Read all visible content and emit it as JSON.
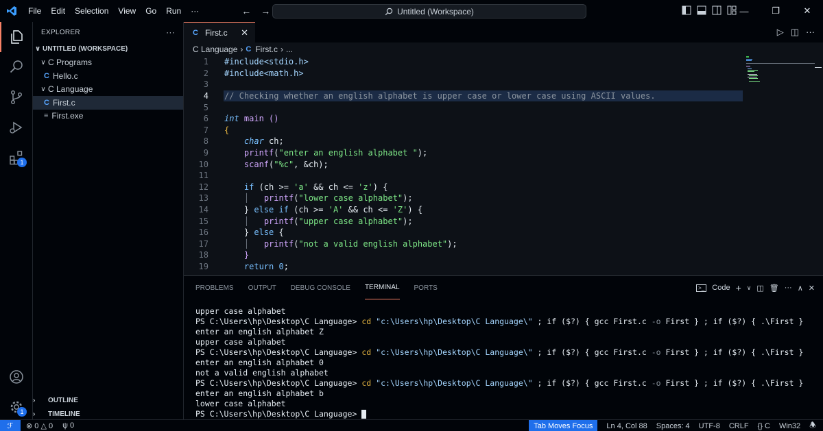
{
  "titlebar": {
    "menu": [
      "File",
      "Edit",
      "Selection",
      "View",
      "Go",
      "Run",
      "···"
    ],
    "command_center": "Untitled (Workspace)"
  },
  "activitybar": {
    "extensions_badge": "1",
    "settings_badge": "1"
  },
  "sidebar": {
    "title": "EXPLORER",
    "more": "···",
    "workspace": "UNTITLED (WORKSPACE)",
    "items": [
      {
        "label": "C Programs",
        "type": "folder"
      },
      {
        "label": "Hello.c",
        "type": "c"
      },
      {
        "label": "C Language",
        "type": "folder"
      },
      {
        "label": "First.c",
        "type": "c"
      },
      {
        "label": "First.exe",
        "type": "exe"
      }
    ],
    "outline": "OUTLINE",
    "timeline": "TIMELINE"
  },
  "editor": {
    "tab_label": "First.c",
    "breadcrumb": [
      "C Language",
      "First.c",
      "..."
    ],
    "lines": [
      "1",
      "2",
      "3",
      "4",
      "5",
      "6",
      "7",
      "8",
      "9",
      "10",
      "11",
      "12",
      "13",
      "14",
      "15",
      "16",
      "17",
      "18",
      "19"
    ],
    "code": {
      "l1": "#include<stdio.h>",
      "l2": "#include<math.h>",
      "l4": "// Checking whether an english alphabet is upper case or lower case using ASCII values.",
      "l6_type": "int",
      "l6_rest": " main ()",
      "l7": "{",
      "l8_type": "char",
      "l8_rest": " ch;",
      "l9_fn": "printf",
      "l9_str": "\"enter an english alphabet \"",
      "l10_fn": "scanf",
      "l10_str": "\"%c\"",
      "l10_rest": ", &ch);",
      "l12_if": "if",
      "l12_a": " (ch >= ",
      "l12_s1": "'a'",
      "l12_b": " && ch <= ",
      "l12_s2": "'z'",
      "l12_c": ") {",
      "l13_fn": "printf",
      "l13_str": "\"lower case alphabet\"",
      "l14_a": "} ",
      "l14_else": "else if",
      "l14_b": " (ch >= ",
      "l14_s1": "'A'",
      "l14_c": " && ch <= ",
      "l14_s2": "'Z'",
      "l14_d": ") {",
      "l15_fn": "printf",
      "l15_str": "\"upper case alphabet\"",
      "l16_a": "} ",
      "l16_else": "else",
      "l16_b": " {",
      "l17_fn": "printf",
      "l17_str": "\"not a valid english alphabet\"",
      "l18": "}",
      "l19_kw": "return",
      "l19_num": "0",
      "l19_end": ";"
    }
  },
  "panel": {
    "tabs": [
      "PROBLEMS",
      "OUTPUT",
      "DEBUG CONSOLE",
      "TERMINAL",
      "PORTS"
    ],
    "terminal_label": "Code",
    "terminal": {
      "t1": "upper case alphabet",
      "prompt": "PS C:\\Users\\hp\\Desktop\\C Language>",
      "cd": "cd",
      "path": "\"c:\\Users\\hp\\Desktop\\C Language\\\"",
      "if_gcc": " ; if ($?) { gcc First.c ",
      "flag": "-o",
      "if_gcc2": " First } ; if ($?) { .\\First }",
      "t3": "enter an english alphabet Z",
      "t4": "upper case alphabet",
      "t6": "enter an english alphabet 0",
      "t7": "not a valid english alphabet",
      "t9": "enter an english alphabet b",
      "t10": "lower case alphabet"
    }
  },
  "statusbar": {
    "errors": "0",
    "warnings": "0",
    "ports": "0",
    "tab_focus": "Tab Moves Focus",
    "position": "Ln 4, Col 88",
    "spaces": "Spaces: 4",
    "encoding": "UTF-8",
    "eol": "CRLF",
    "language": "C",
    "platform": "Win32"
  }
}
